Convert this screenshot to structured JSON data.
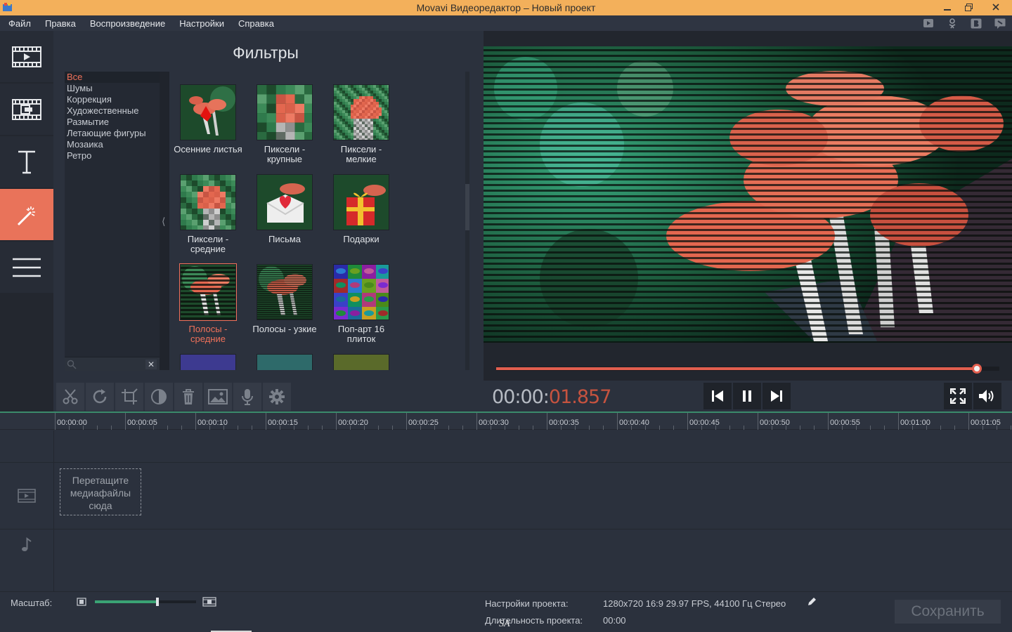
{
  "window": {
    "title": "Movavi Видеоредактор – Новый проект"
  },
  "menu": [
    "Файл",
    "Правка",
    "Воспроизведение",
    "Настройки",
    "Справка"
  ],
  "social_icons": [
    "youtube-icon",
    "odnoklassniki-icon",
    "vkontakte-icon",
    "livejournal-icon"
  ],
  "nav": [
    {
      "icon": "import-media-icon",
      "active": false
    },
    {
      "icon": "transitions-icon",
      "active": false
    },
    {
      "icon": "titles-icon",
      "active": false
    },
    {
      "icon": "filters-wand-icon",
      "active": true
    },
    {
      "icon": "more-menu-icon",
      "active": false
    }
  ],
  "filters": {
    "title": "Фильтры",
    "categories": [
      "Все",
      "Шумы",
      "Коррекция",
      "Художественные",
      "Размытие",
      "Летающие фигуры",
      "Мозаика",
      "Ретро"
    ],
    "selected_category": "Все",
    "tiles": [
      {
        "label": "Осенние листья",
        "style": "autumn"
      },
      {
        "label": "Пиксели - крупные",
        "style": "pixel-large"
      },
      {
        "label": "Пиксели - мелкие",
        "style": "pixel-small"
      },
      {
        "label": "Пиксели - средние",
        "style": "pixel-medium"
      },
      {
        "label": "Письма",
        "style": "letters"
      },
      {
        "label": "Подарки",
        "style": "gifts"
      },
      {
        "label": "Полосы - средние",
        "style": "stripes-medium",
        "selected": true
      },
      {
        "label": "Полосы - узкие",
        "style": "stripes-narrow"
      },
      {
        "label": "Поп-арт 16 плиток",
        "style": "popart16"
      }
    ]
  },
  "toolbar": [
    "scissors-icon",
    "rotate-icon",
    "crop-icon",
    "color-adjust-icon",
    "delete-icon",
    "image-icon",
    "microphone-icon",
    "settings-gear-icon"
  ],
  "player": {
    "timecode_grey": "00:00:",
    "timecode_red": "01.857",
    "progress": 0.955,
    "buttons": [
      "skip-back-icon",
      "pause-icon",
      "skip-forward-icon"
    ],
    "right_buttons": [
      "fullscreen-icon",
      "volume-icon"
    ]
  },
  "ruler": [
    "00:00:00",
    "00:00:05",
    "00:00:10",
    "00:00:15",
    "00:00:20",
    "00:00:25",
    "00:00:30",
    "00:00:35",
    "00:00:40",
    "00:00:45",
    "00:00:50",
    "00:00:55",
    "00:01:00",
    "00:01:05"
  ],
  "timeline": {
    "dropzone_text": "Перетащите медиафайлы сюда",
    "video_track_icon": "film-icon",
    "audio_track_icon": "music-note-icon"
  },
  "bottom": {
    "zoom_label": "Масштаб:",
    "zoom_level": 0.62,
    "project_settings_label": "Настройки проекта:",
    "project_settings_value": "1280x720 16:9 29.97 FPS, 44100 Гц Стерео",
    "duration_label": "Длительность проекта:",
    "duration_value": "00:00",
    "save_label": "Сохранить",
    "watermark": "SA"
  },
  "colors": {
    "accent": "#e9735a",
    "titlebar": "#f3b05b",
    "progress": "#e25f4f",
    "zoom_fill": "#3aa374"
  }
}
